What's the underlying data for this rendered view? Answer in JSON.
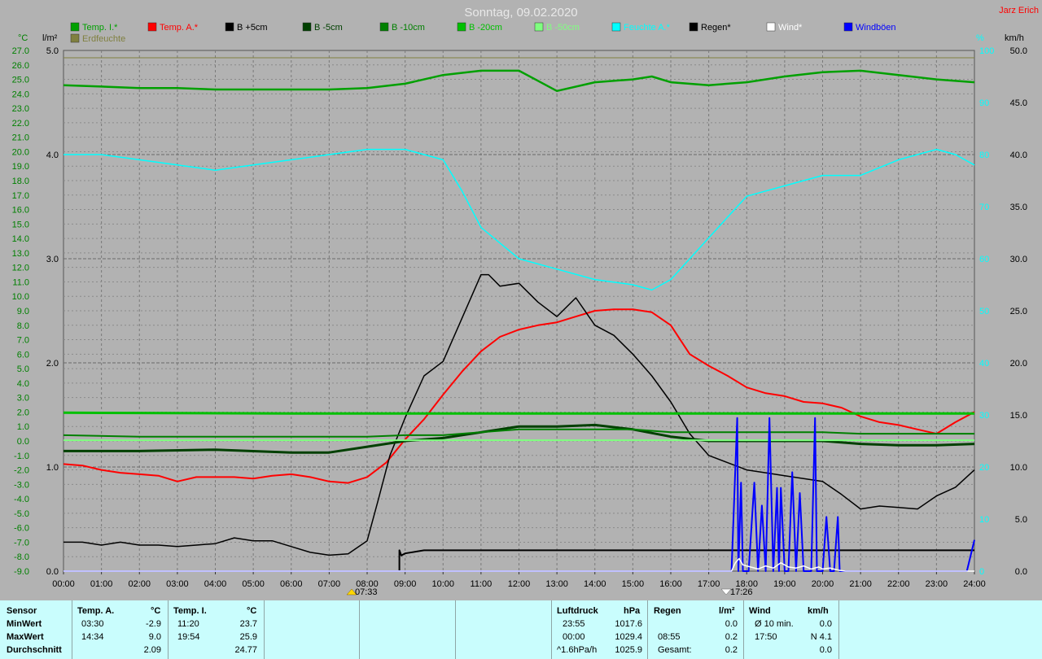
{
  "title": "Sonntag, 09.02.2020",
  "author": "Jarz Erich",
  "axes": {
    "left_temp_unit": "°C",
    "left_rain_unit": "l/m²",
    "right_pct_unit": "%",
    "right_wind_unit": "km/h",
    "temp_ticks": [
      "27.0",
      "26.0",
      "25.0",
      "24.0",
      "23.0",
      "22.0",
      "21.0",
      "20.0",
      "19.0",
      "18.0",
      "17.0",
      "16.0",
      "15.0",
      "14.0",
      "13.0",
      "12.0",
      "11.0",
      "10.0",
      "9.0",
      "8.0",
      "7.0",
      "6.0",
      "5.0",
      "4.0",
      "3.0",
      "2.0",
      "1.0",
      "0.0",
      "-1.0",
      "-2.0",
      "-3.0",
      "-4.0",
      "-5.0",
      "-6.0",
      "-7.0",
      "-8.0",
      "-9.0"
    ],
    "rain_ticks": [
      "5.0",
      "4.0",
      "3.0",
      "2.0",
      "1.0",
      "0.0"
    ],
    "pct_ticks": [
      "100",
      "90",
      "80",
      "70",
      "60",
      "50",
      "40",
      "30",
      "20",
      "10",
      "0"
    ],
    "wind_ticks": [
      "50.0",
      "45.0",
      "40.0",
      "35.0",
      "30.0",
      "25.0",
      "20.0",
      "15.0",
      "10.0",
      "5.0",
      "0.0"
    ],
    "time_ticks": [
      "00:00",
      "01:00",
      "02:00",
      "03:00",
      "04:00",
      "05:00",
      "06:00",
      "07:00",
      "08:00",
      "09:00",
      "10:00",
      "11:00",
      "12:00",
      "13:00",
      "14:00",
      "15:00",
      "16:00",
      "17:00",
      "18:00",
      "19:00",
      "20:00",
      "21:00",
      "22:00",
      "23:00",
      "24:00"
    ],
    "sunrise": "07:33",
    "sunset": "17:26"
  },
  "legend": [
    {
      "label": "Temp. I.*",
      "color": "#00a000"
    },
    {
      "label": "Temp. A.*",
      "color": "#ff0000"
    },
    {
      "label": "B +5cm",
      "color": "#000000"
    },
    {
      "label": "B -5cm",
      "color": "#004000"
    },
    {
      "label": "B -10cm",
      "color": "#008000"
    },
    {
      "label": "B -20cm",
      "color": "#00c000"
    },
    {
      "label": "B -50cm",
      "color": "#80ff80"
    },
    {
      "label": "Feuchte A.*",
      "color": "#00ffff"
    },
    {
      "label": "Regen*",
      "color": "#000000"
    },
    {
      "label": "Wind*",
      "color": "#ffffff"
    },
    {
      "label": "Windböen",
      "color": "#0000ff"
    },
    {
      "label": "Erdfeuchte",
      "color": "#808040"
    }
  ],
  "chart_data": {
    "type": "line",
    "x_unit": "hours",
    "xlim": [
      0,
      24
    ],
    "temp_ylim": [
      -9,
      27
    ],
    "rain_ylim": [
      0,
      5
    ],
    "pct_ylim": [
      0,
      100
    ],
    "wind_ylim": [
      0,
      50
    ],
    "series": [
      {
        "name": "Temp. A.*",
        "axis": "temp",
        "color": "#ff0000",
        "x": [
          0,
          0.5,
          1,
          1.5,
          2,
          2.5,
          3,
          3.5,
          4,
          4.5,
          5,
          5.5,
          6,
          6.5,
          7,
          7.5,
          8,
          8.5,
          9,
          9.5,
          10,
          10.5,
          11,
          11.5,
          12,
          12.5,
          13,
          13.5,
          14,
          14.5,
          15,
          15.5,
          16,
          16.5,
          17,
          17.5,
          18,
          18.5,
          19,
          19.5,
          20,
          20.5,
          21,
          21.5,
          22,
          22.5,
          23,
          23.5,
          24
        ],
        "y": [
          -1.6,
          -1.7,
          -2.0,
          -2.2,
          -2.3,
          -2.4,
          -2.8,
          -2.5,
          -2.5,
          -2.5,
          -2.6,
          -2.4,
          -2.3,
          -2.5,
          -2.8,
          -2.9,
          -2.5,
          -1.5,
          0.1,
          1.5,
          3.2,
          4.8,
          6.2,
          7.2,
          7.7,
          8.0,
          8.2,
          8.6,
          9.0,
          9.1,
          9.1,
          8.9,
          8.0,
          6.0,
          5.2,
          4.5,
          3.7,
          3.3,
          3.1,
          2.7,
          2.6,
          2.3,
          1.7,
          1.3,
          1.1,
          0.8,
          0.5,
          1.3,
          2.0
        ]
      },
      {
        "name": "B +5cm",
        "axis": "temp",
        "color": "#000000",
        "x": [
          0,
          0.5,
          1,
          1.5,
          2,
          2.5,
          3,
          3.5,
          4,
          4.5,
          5,
          5.5,
          6,
          6.5,
          7,
          7.5,
          8,
          8.3,
          8.6,
          9,
          9.5,
          10,
          10.5,
          11,
          11.2,
          11.5,
          12,
          12.5,
          13,
          13.5,
          14,
          14.5,
          15,
          15.5,
          16,
          16.5,
          17,
          17.5,
          18,
          18.5,
          19,
          19.5,
          20,
          20.5,
          21,
          21.5,
          22,
          22.5,
          23,
          23.5,
          24
        ],
        "y": [
          -7.0,
          -7.0,
          -7.2,
          -7.0,
          -7.2,
          -7.2,
          -7.3,
          -7.2,
          -7.1,
          -6.7,
          -6.9,
          -6.9,
          -7.3,
          -7.7,
          -7.9,
          -7.8,
          -6.9,
          -4.0,
          -1.0,
          1.6,
          4.5,
          5.5,
          8.5,
          11.5,
          11.5,
          10.7,
          10.9,
          9.6,
          8.6,
          9.9,
          8.0,
          7.3,
          6.0,
          4.5,
          2.7,
          0.5,
          -1.0,
          -1.5,
          -2.0,
          -2.2,
          -2.4,
          -2.6,
          -2.8,
          -3.7,
          -4.7,
          -4.5,
          -4.6,
          -4.7,
          -3.8,
          -3.2,
          -2.0
        ]
      },
      {
        "name": "B -5cm",
        "axis": "temp",
        "color": "#004000",
        "x": [
          0,
          2,
          4,
          6,
          7,
          8,
          9,
          10,
          11,
          12,
          13,
          14,
          15,
          16,
          17,
          18,
          19,
          20,
          21,
          22,
          23,
          24
        ],
        "y": [
          -0.7,
          -0.7,
          -0.6,
          -0.8,
          -0.8,
          -0.4,
          0.0,
          0.2,
          0.6,
          1.0,
          1.0,
          1.1,
          0.8,
          0.3,
          0.0,
          0.0,
          0.0,
          0.0,
          -0.2,
          -0.3,
          -0.3,
          -0.2
        ]
      },
      {
        "name": "B -10cm",
        "axis": "temp",
        "color": "#008000",
        "x": [
          0,
          2,
          4,
          6,
          7,
          8,
          9,
          10,
          11,
          12,
          13,
          14,
          15,
          16,
          17,
          18,
          19,
          20,
          21,
          22,
          23,
          24
        ],
        "y": [
          0.4,
          0.3,
          0.3,
          0.3,
          0.3,
          0.3,
          0.4,
          0.4,
          0.6,
          0.8,
          0.8,
          0.8,
          0.8,
          0.6,
          0.6,
          0.6,
          0.6,
          0.6,
          0.5,
          0.5,
          0.5,
          0.5
        ]
      },
      {
        "name": "B -20cm",
        "axis": "temp",
        "color": "#00c000",
        "x": [
          0,
          6,
          12,
          18,
          24
        ],
        "y": [
          1.95,
          1.9,
          1.9,
          1.9,
          1.9
        ]
      },
      {
        "name": "B -50cm",
        "axis": "temp",
        "color": "#80ff80",
        "x": [
          0,
          24
        ],
        "y": [
          0.05,
          0.05
        ]
      },
      {
        "name": "Temp. I.*",
        "axis": "temp",
        "color": "#00a000",
        "x": [
          0,
          1,
          2,
          3,
          4,
          5,
          6,
          7,
          8,
          9,
          10,
          11,
          12,
          12.5,
          13,
          14,
          15,
          15.5,
          16,
          17,
          18,
          19,
          20,
          21,
          22,
          23,
          24
        ],
        "y": [
          24.6,
          24.5,
          24.4,
          24.4,
          24.3,
          24.3,
          24.3,
          24.3,
          24.4,
          24.7,
          25.3,
          25.6,
          25.6,
          24.9,
          24.2,
          24.8,
          25.0,
          25.2,
          24.8,
          24.6,
          24.8,
          25.2,
          25.5,
          25.6,
          25.3,
          25.0,
          24.8
        ]
      },
      {
        "name": "Feuchte A.*",
        "axis": "pct",
        "color": "#00ffff",
        "x": [
          0,
          1,
          2,
          3,
          4,
          5,
          6,
          7,
          8,
          9,
          10,
          10.5,
          11,
          11.5,
          12,
          13,
          14,
          15,
          15.5,
          16,
          16.5,
          17,
          17.5,
          18,
          19,
          20,
          21,
          22,
          23,
          23.5,
          24
        ],
        "y": [
          80,
          80,
          79,
          78,
          77,
          78,
          79,
          80,
          81,
          81,
          79,
          73,
          66,
          63,
          60,
          58,
          56,
          55,
          54,
          56,
          60,
          64,
          68,
          72,
          74,
          76,
          76,
          79,
          81,
          80,
          78
        ]
      },
      {
        "name": "Erdfeuchte",
        "axis": "rain",
        "color": "#808040",
        "x": [
          0,
          24
        ],
        "y": [
          4.93,
          4.93
        ]
      },
      {
        "name": "Regen*",
        "axis": "rain",
        "color": "#000000",
        "x": [
          0,
          8.85,
          8.85,
          8.9,
          9,
          9.5,
          10,
          24
        ],
        "y": [
          0,
          0,
          0.2,
          0.15,
          0.17,
          0.2,
          0.2,
          0.2
        ]
      },
      {
        "name": "Windböen",
        "axis": "wind",
        "color": "#0000ff",
        "x": [
          0,
          17.6,
          17.75,
          17.78,
          17.85,
          17.9,
          18.05,
          18.2,
          18.3,
          18.4,
          18.5,
          18.6,
          18.7,
          18.8,
          18.85,
          18.9,
          19.0,
          19.1,
          19.2,
          19.3,
          19.4,
          19.5,
          19.6,
          19.7,
          19.8,
          19.85,
          19.9,
          20.0,
          20.1,
          20.2,
          20.3,
          20.4,
          20.45,
          20.5,
          20.6,
          20.7,
          20.8,
          20.9,
          21.0,
          21.1,
          21.2,
          23.8,
          24
        ],
        "y": [
          0,
          0,
          14.7,
          0,
          8.5,
          0,
          0,
          8.5,
          0,
          6.3,
          0,
          14.7,
          0,
          8.0,
          0,
          8.0,
          0,
          0,
          9.5,
          0,
          7.5,
          0,
          0,
          0,
          14.7,
          0,
          0,
          0,
          5.2,
          0,
          0,
          5.2,
          0,
          0,
          0,
          0,
          0,
          0,
          0,
          0,
          0,
          0,
          3.0
        ]
      },
      {
        "name": "Wind*",
        "axis": "wind",
        "color": "#ffffff",
        "x": [
          0,
          17.6,
          17.7,
          17.8,
          17.9,
          18.1,
          18.3,
          18.5,
          18.7,
          18.9,
          19.1,
          19.3,
          19.5,
          19.7,
          19.9,
          20.0,
          20.2,
          20.4,
          20.6,
          24
        ],
        "y": [
          0,
          0,
          0.8,
          1.2,
          0.6,
          0.4,
          0.2,
          0.5,
          0.3,
          0.8,
          0.4,
          0.3,
          0.5,
          0.2,
          0.4,
          0.2,
          0.3,
          0.1,
          0,
          0
        ]
      }
    ]
  },
  "stats": {
    "sensor": {
      "header": "Sensor",
      "rows": [
        "MinWert",
        "MaxWert",
        "Durchschnitt"
      ]
    },
    "temp_a": {
      "header": "Temp. A.",
      "unit": "°C",
      "min_time": "03:30",
      "min_val": "-2.9",
      "max_time": "14:34",
      "max_val": "9.0",
      "avg": "2.09"
    },
    "temp_i": {
      "header": "Temp. I.",
      "unit": "°C",
      "min_time": "11:20",
      "min_val": "23.7",
      "max_time": "19:54",
      "max_val": "25.9",
      "avg": "24.77"
    },
    "luftdruck": {
      "header": "Luftdruck",
      "unit": "hPa",
      "min_time": "23:55",
      "min_val": "1017.6",
      "max_time": "00:00",
      "max_val": "1029.4",
      "trend_label": "^1.6hPa/h",
      "trend_val": "1025.9"
    },
    "regen": {
      "header": "Regen",
      "unit": "l/m²",
      "row1_time": "",
      "row1_val": "0.0",
      "row2_time": "08:55",
      "row2_val": "0.2",
      "row3_label": "Gesamt:",
      "row3_val": "0.2"
    },
    "wind": {
      "header": "Wind",
      "unit": "km/h",
      "row1_label": "Ø 10 min.",
      "row1_val": "0.0",
      "row2_time": "17:50",
      "row2_val": "N 4.1",
      "row3_val": "0.0"
    }
  }
}
